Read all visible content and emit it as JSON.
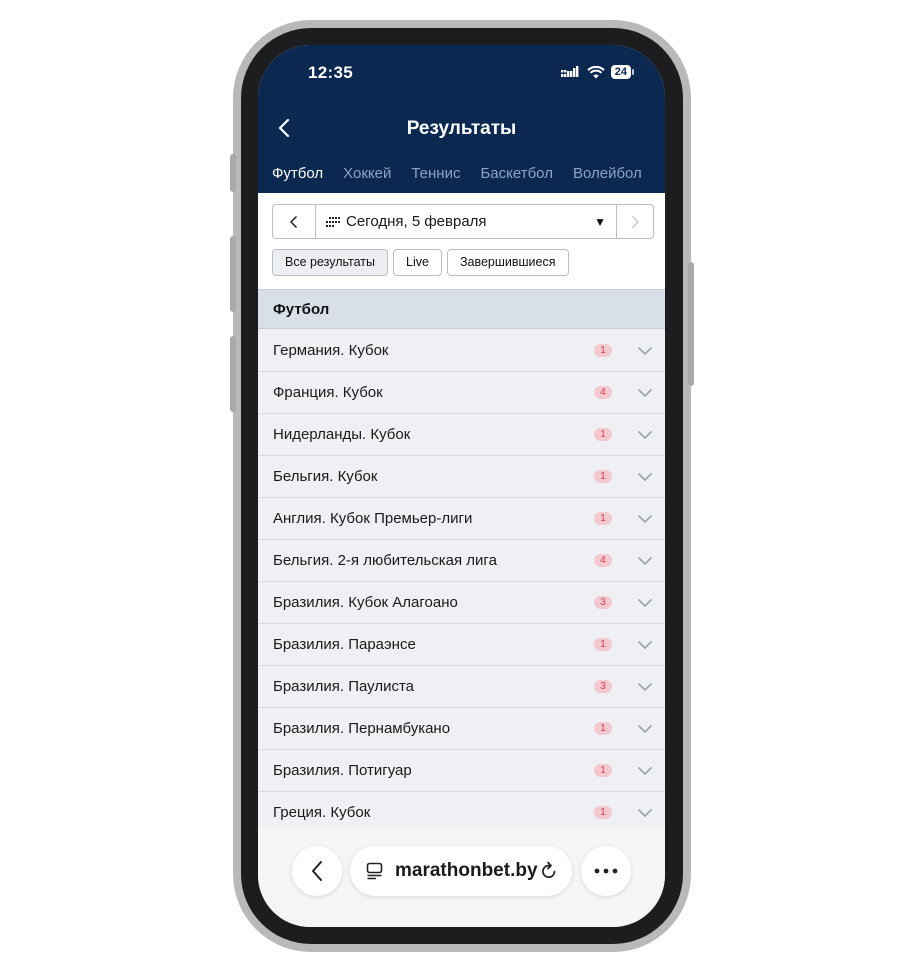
{
  "status_bar": {
    "time": "12:35",
    "battery": "24"
  },
  "header": {
    "title": "Результаты"
  },
  "sport_tabs": [
    {
      "label": "Футбол",
      "active": true
    },
    {
      "label": "Хоккей",
      "active": false
    },
    {
      "label": "Теннис",
      "active": false
    },
    {
      "label": "Баскетбол",
      "active": false
    },
    {
      "label": "Волейбол",
      "active": false
    }
  ],
  "date_filter": {
    "label": "Сегодня, 5 февраля"
  },
  "result_filters": [
    {
      "label": "Все результаты",
      "active": true
    },
    {
      "label": "Live",
      "active": false
    },
    {
      "label": "Завершившиеся",
      "active": false
    }
  ],
  "section": {
    "title": "Футбол"
  },
  "leagues": [
    {
      "name": "Германия. Кубок",
      "count": "1"
    },
    {
      "name": "Франция. Кубок",
      "count": "4"
    },
    {
      "name": "Нидерланды. Кубок",
      "count": "1"
    },
    {
      "name": "Бельгия. Кубок",
      "count": "1"
    },
    {
      "name": "Англия. Кубок Премьер-лиги",
      "count": "1"
    },
    {
      "name": "Бельгия. 2-я любительская лига",
      "count": "4"
    },
    {
      "name": "Бразилия. Кубок Алагоано",
      "count": "3"
    },
    {
      "name": "Бразилия. Параэнсе",
      "count": "1"
    },
    {
      "name": "Бразилия. Паулиста",
      "count": "3"
    },
    {
      "name": "Бразилия. Пернамбукано",
      "count": "1"
    },
    {
      "name": "Бразилия. Потигуар",
      "count": "1"
    },
    {
      "name": "Греция. Кубок",
      "count": "1"
    }
  ],
  "browser": {
    "url": "marathonbet.by"
  },
  "colors": {
    "header_bg": "#0a2850",
    "badge_bg": "#f4c8cf",
    "badge_text": "#d8404f"
  }
}
